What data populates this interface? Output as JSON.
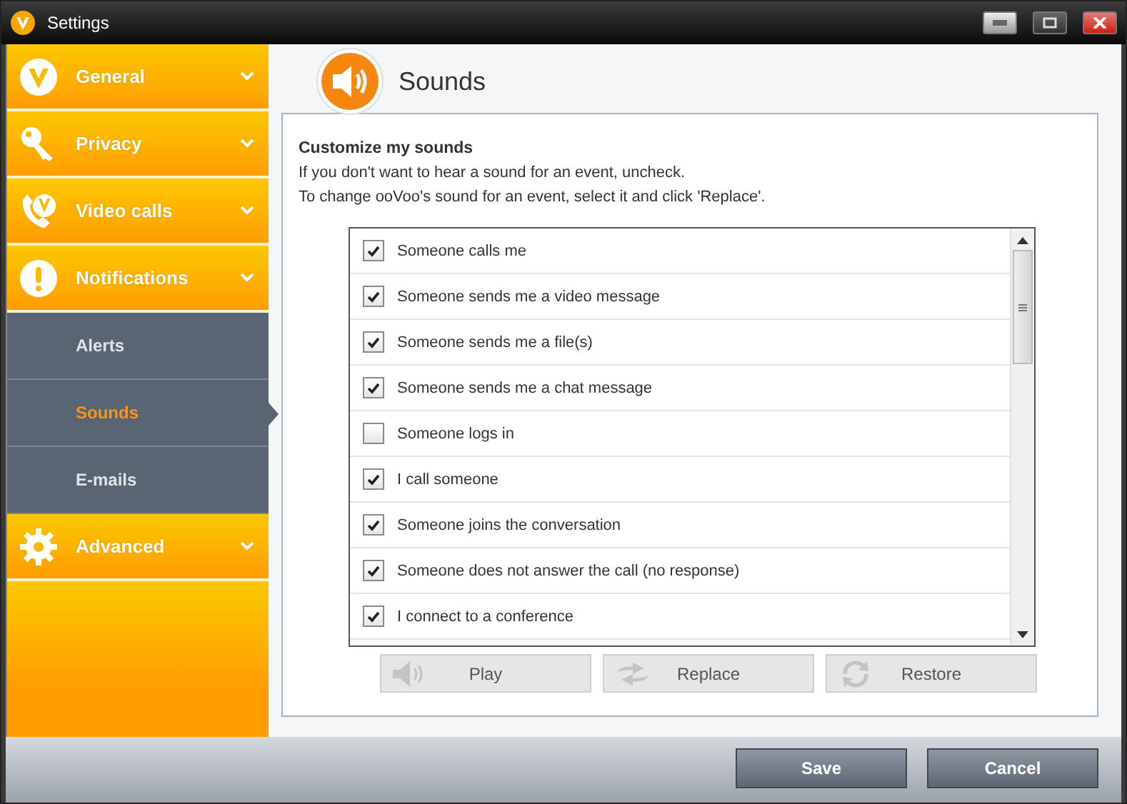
{
  "window": {
    "title": "Settings"
  },
  "sidebar": {
    "items": [
      {
        "label": "General",
        "kind": "logo"
      },
      {
        "label": "Privacy",
        "kind": "key"
      },
      {
        "label": "Video calls",
        "kind": "phone"
      },
      {
        "label": "Notifications",
        "kind": "alert",
        "children": [
          {
            "label": "Alerts",
            "selected": false
          },
          {
            "label": "Sounds",
            "selected": true
          },
          {
            "label": "E-mails",
            "selected": false
          }
        ]
      },
      {
        "label": "Advanced",
        "kind": "gear"
      }
    ]
  },
  "page": {
    "title": "Sounds",
    "heading": "Customize my sounds",
    "lines": [
      "If you don't want to hear a sound for an event, uncheck.",
      "To change ooVoo's sound for an event, select it and click 'Replace'."
    ]
  },
  "events": [
    {
      "label": "Someone calls me",
      "checked": true
    },
    {
      "label": "Someone sends me a video message",
      "checked": true
    },
    {
      "label": "Someone sends me a file(s)",
      "checked": true
    },
    {
      "label": "Someone sends me a chat message",
      "checked": true
    },
    {
      "label": "Someone logs in",
      "checked": false
    },
    {
      "label": "I call someone",
      "checked": true
    },
    {
      "label": "Someone joins the conversation",
      "checked": true
    },
    {
      "label": "Someone does not answer the call (no response)",
      "checked": true
    },
    {
      "label": "I connect to a conference",
      "checked": true
    }
  ],
  "actions": [
    {
      "label": "Play",
      "kind": "speaker",
      "disabled": true
    },
    {
      "label": "Replace",
      "kind": "swap",
      "disabled": true
    },
    {
      "label": "Restore",
      "kind": "refresh",
      "disabled": true
    }
  ],
  "footer": {
    "buttons": [
      "Save",
      "Cancel"
    ]
  }
}
